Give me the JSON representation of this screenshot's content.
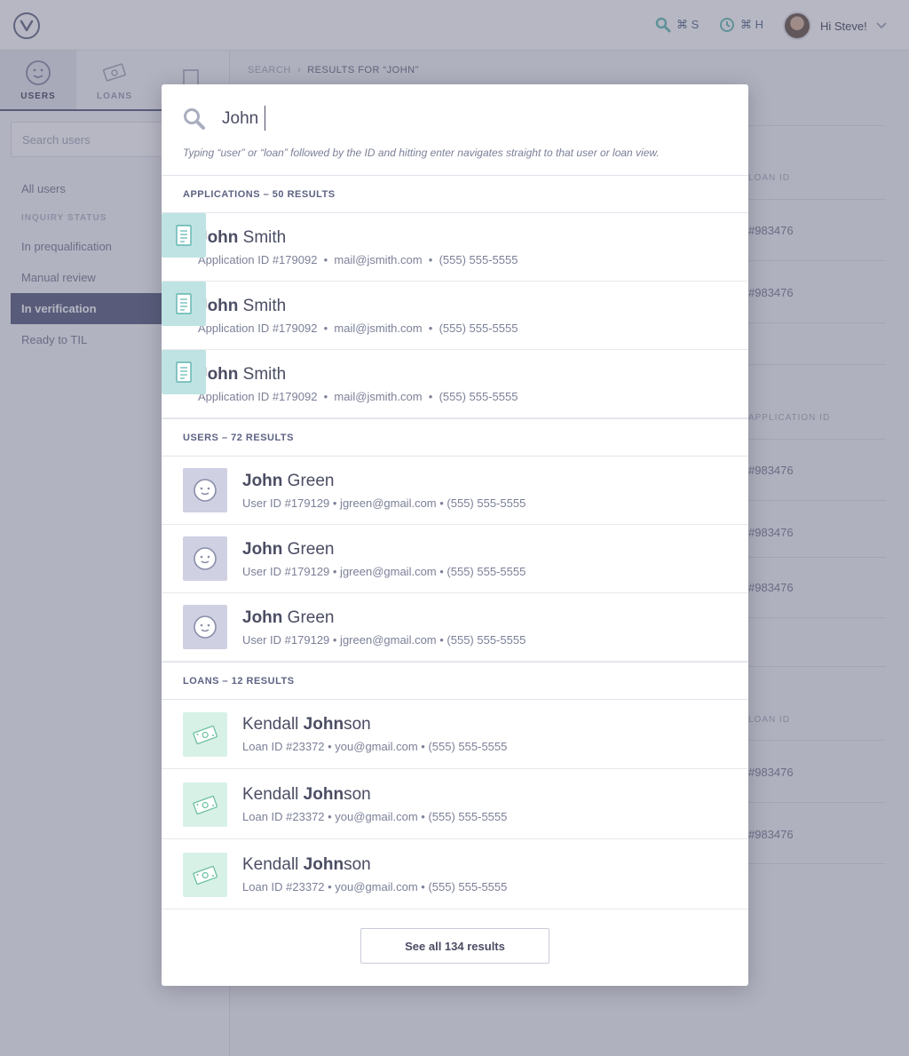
{
  "topbar": {
    "shortcut_search": "⌘ S",
    "shortcut_history": "⌘ H",
    "greeting": "Hi Steve!"
  },
  "sidebar": {
    "tabs": [
      {
        "label": "USERS",
        "icon": "smiley-icon"
      },
      {
        "label": "LOANS",
        "icon": "money-icon"
      }
    ],
    "search_placeholder": "Search users",
    "items": [
      {
        "label": "All users"
      },
      {
        "label": "INQUIRY STATUS"
      },
      {
        "label": "In prequalification"
      },
      {
        "label": "Manual review"
      },
      {
        "label": "In verification"
      },
      {
        "label": "Ready to TIL"
      }
    ]
  },
  "breadcrumb": {
    "root": "SEARCH",
    "current": "RESULTS FOR “JOHN”"
  },
  "background_table": {
    "headers": [
      "LOAN ID",
      "APPLICATION ID",
      "LOAN ID"
    ],
    "value": "#983476"
  },
  "modal": {
    "query": "John",
    "hint": "Typing “user” or “loan” followed by the ID and hitting enter navigates straight to that user or loan view.",
    "sections": [
      {
        "title": "APPLICATIONS  –  50 RESULTS",
        "kind": "app",
        "results": [
          {
            "bold": "John",
            "rest": " Smith",
            "meta": "Application ID #179092  •  mail@jsmith.com  •  (555) 555-5555"
          },
          {
            "bold": "John",
            "rest": " Smith",
            "meta": "Application ID #179092  •  mail@jsmith.com  •  (555) 555-5555"
          },
          {
            "bold": "John",
            "rest": " Smith",
            "meta": "Application ID #179092  •  mail@jsmith.com  •  (555) 555-5555"
          }
        ]
      },
      {
        "title": "USERS  –  72 RESULTS",
        "kind": "user",
        "results": [
          {
            "bold": "John",
            "rest": " Green",
            "meta": "User ID #179129 • jgreen@gmail.com • (555) 555-5555"
          },
          {
            "bold": "John",
            "rest": " Green",
            "meta": "User ID #179129 • jgreen@gmail.com • (555) 555-5555"
          },
          {
            "bold": "John",
            "rest": " Green",
            "meta": "User ID #179129 • jgreen@gmail.com • (555) 555-5555"
          }
        ]
      },
      {
        "title": "LOANS  –  12 RESULTS",
        "kind": "loan",
        "results": [
          {
            "pre": "Kendall ",
            "bold": "John",
            "rest": "son",
            "meta": "Loan ID #23372 • you@gmail.com • (555) 555-5555"
          },
          {
            "pre": "Kendall ",
            "bold": "John",
            "rest": "son",
            "meta": "Loan ID #23372 • you@gmail.com • (555) 555-5555"
          },
          {
            "pre": "Kendall ",
            "bold": "John",
            "rest": "son",
            "meta": "Loan ID #23372 • you@gmail.com • (555) 555-5555"
          }
        ]
      }
    ],
    "see_all_label": "See all 134 results"
  }
}
